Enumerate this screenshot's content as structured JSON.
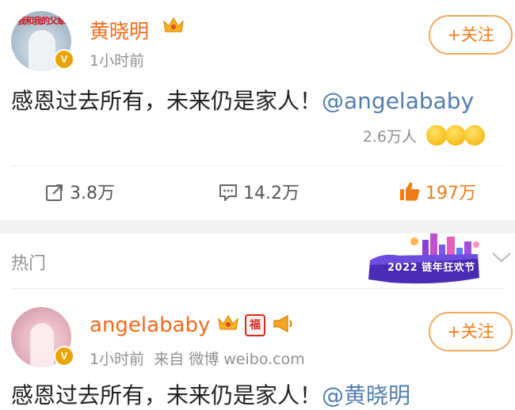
{
  "post1": {
    "avatar_text": "我和我的父辈",
    "username": "黄晓明",
    "time": "1小时前",
    "follow_label": "+关注",
    "content_text": "感恩过去所有，未来仍是家人！",
    "content_mention": "@angelababy",
    "likes_summary": "2.6万人",
    "reposts": "3.8万",
    "comments": "14.2万",
    "likes": "197万"
  },
  "section": {
    "hot_label": "热门",
    "banner_year": "2022",
    "banner_text": "链年狂欢节"
  },
  "post2": {
    "username": "angelababy",
    "fu_badge": "福",
    "time": "1小时前",
    "source": "来自 微博 weibo.com",
    "follow_label": "+关注",
    "content_text": "感恩过去所有，未来仍是家人！",
    "content_mention": "@黄晓明"
  },
  "colors": {
    "accent_orange": "#f07c16",
    "mention_blue": "#507daf",
    "vip_gold": "#e9a400"
  }
}
